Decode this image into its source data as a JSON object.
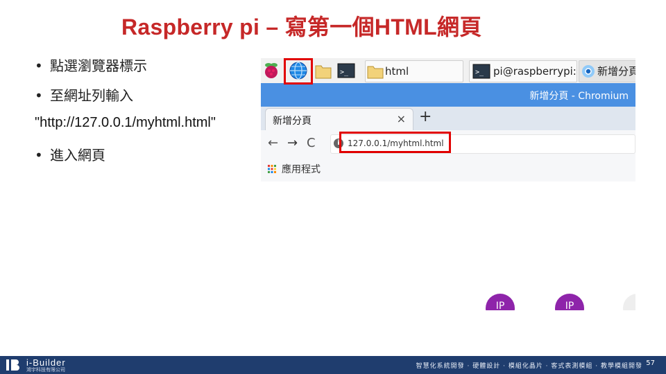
{
  "slide": {
    "title": "Raspberry pi – 寫第一個HTML網頁",
    "bullets": [
      "點選瀏覽器標示",
      "至網址列輸入",
      "進入網頁"
    ],
    "bullet_symbol": "•",
    "url_line": "\"http://127.0.0.1/myhtml.html\"",
    "page_number": "57"
  },
  "taskbar": {
    "folder_window": "html",
    "terminal_window": "pi@raspberrypi: ~",
    "chrome_window": "新增分頁",
    "terminal_prompt": ">_"
  },
  "chrome": {
    "window_title": "新增分頁 - Chromium",
    "tab_label": "新增分頁",
    "tab_close": "×",
    "new_tab": "+",
    "back": "←",
    "forward": "→",
    "reload": "C",
    "info": "i",
    "address": "127.0.0.1/myhtml.html",
    "bookmark_label": "應用程式"
  },
  "avatars": [
    "IP",
    "IP"
  ],
  "footer": {
    "brand": "i-Builder",
    "company": "鴻宇科技有限公司",
    "tagline": "智慧化系統開發 · 硬體設計 · 模組化晶片 · 客式表測模組 · 教學模組開發"
  },
  "colors": {
    "title": "#c62828",
    "highlight": "#e10000",
    "chrome_title": "#4a90e2",
    "footer": "#1f3d6e",
    "avatar": "#8e24aa"
  }
}
